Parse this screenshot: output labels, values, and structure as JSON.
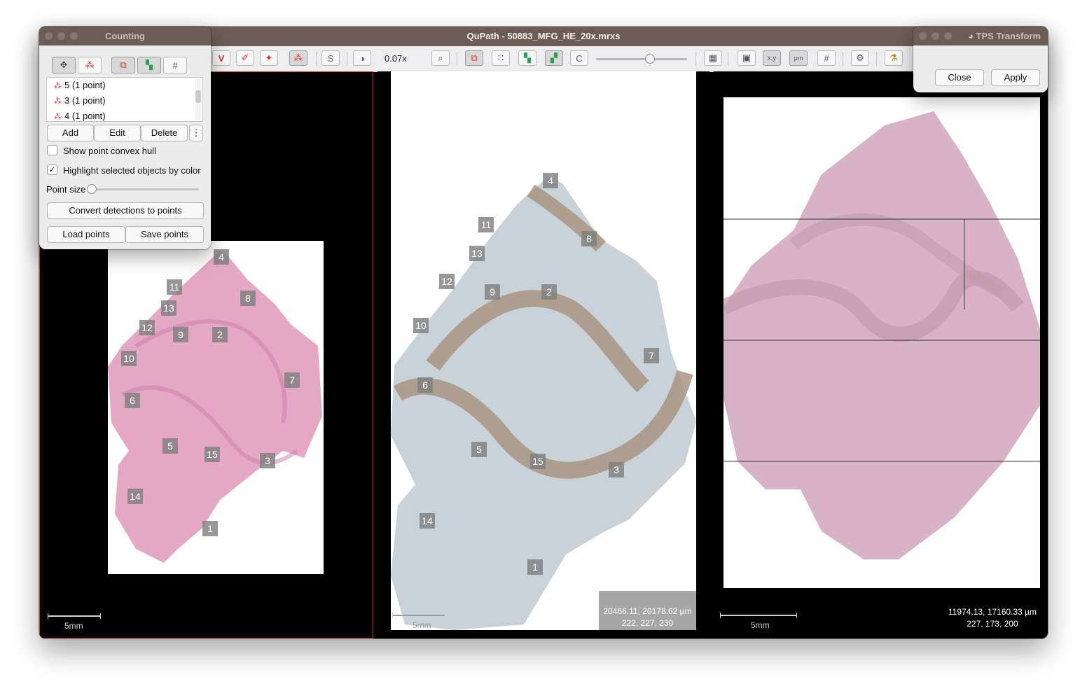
{
  "window": {
    "title": "QuPath - 50883_MFG_HE_20x.mrxs"
  },
  "toolbar": {
    "zoom": "0.07x",
    "text_buttons": [
      "V",
      "S",
      "C"
    ]
  },
  "viewers": [
    {
      "scale": "5mm"
    },
    {
      "scale": "5mm",
      "cursor_coords": "20466.11, 20178.62 µm",
      "rgb": "222, 227, 230"
    },
    {
      "scale": "5mm",
      "cursor_coords": "11974.13, 17160.33 µm",
      "rgb": "227, 173, 200"
    }
  ],
  "counting": {
    "title": "Counting",
    "points": [
      "5 (1 point)",
      "3 (1 point)",
      "4 (1 point)"
    ],
    "add": "Add",
    "edit": "Edit",
    "delete": "Delete",
    "more": "⋮",
    "show_hull": "Show point convex hull",
    "highlight": "Highlight selected objects by color",
    "highlight_checked": true,
    "point_size": "Point size",
    "convert": "Convert detections to points",
    "load": "Load points",
    "save": "Save points"
  },
  "tps": {
    "title": "TPS Transform",
    "close": "Close",
    "apply": "Apply"
  },
  "landmarks": {
    "left": [
      "4",
      "11",
      "8",
      "13",
      "12",
      "9",
      "2",
      "10",
      "7",
      "6",
      "5",
      "15",
      "3",
      "14",
      "1"
    ],
    "middle": [
      "4",
      "11",
      "8",
      "13",
      "12",
      "9",
      "2",
      "10",
      "7",
      "6",
      "5",
      "15",
      "3",
      "14",
      "1"
    ]
  }
}
